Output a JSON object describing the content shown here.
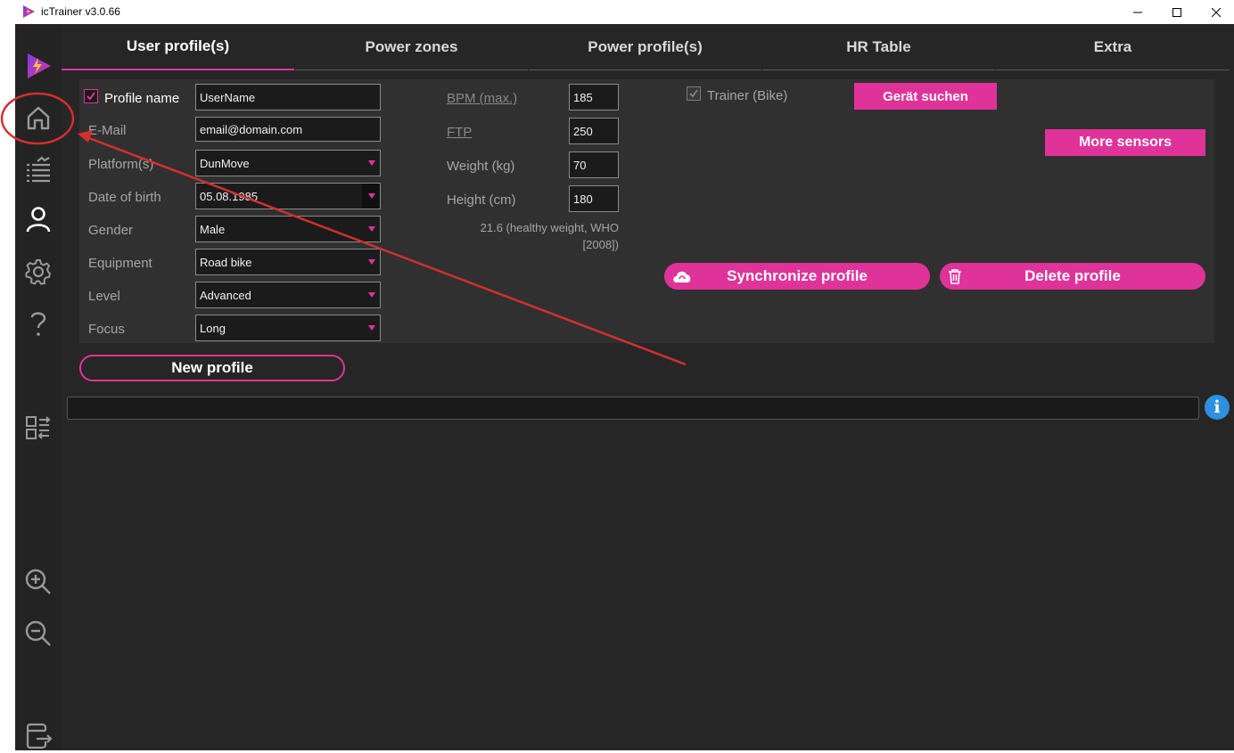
{
  "window": {
    "title": "icTrainer v3.0.66"
  },
  "tabs": [
    {
      "label": "User profile(s)",
      "active": true
    },
    {
      "label": "Power zones",
      "active": false
    },
    {
      "label": "Power profile(s)",
      "active": false
    },
    {
      "label": "HR Table",
      "active": false
    },
    {
      "label": "Extra",
      "active": false
    }
  ],
  "profile": {
    "name_label": "Profile name",
    "name_checked": true,
    "name_value": "UserName",
    "email_label": "E-Mail",
    "email_value": "email@domain.com",
    "platform_label": "Platform(s)",
    "platform_value": "DunMove",
    "dob_label": "Date of birth",
    "dob_value": "05.08.1985",
    "gender_label": "Gender",
    "gender_value": "Male",
    "equipment_label": "Equipment",
    "equipment_value": "Road bike",
    "level_label": "Level",
    "level_value": "Advanced",
    "focus_label": "Focus",
    "focus_value": "Long"
  },
  "metrics": {
    "bpm_label": "BPM (max.)",
    "bpm_value": "185",
    "ftp_label": "FTP",
    "ftp_value": "250",
    "weight_label": "Weight (kg)",
    "weight_value": "70",
    "height_label": "Height (cm)",
    "height_value": "180",
    "bmi_line1": "21.6 (healthy weight, WHO",
    "bmi_line2": "[2008])"
  },
  "devices": {
    "trainer_label": "Trainer (Bike)",
    "search_button": "Gerät suchen",
    "more_sensors_button": "More sensors",
    "sync_button": "Synchronize profile",
    "delete_button": "Delete profile"
  },
  "new_profile_button": "New profile",
  "info_glyph": "i",
  "colors": {
    "accent": "#e0339a",
    "background": "#262626",
    "panel": "#303030",
    "sidebar": "#232323",
    "info": "#2f8fe0",
    "annotation": "#d32f2f"
  },
  "sidebar_icons": [
    "logo-icon",
    "home-icon",
    "workout-list-icon",
    "user-icon",
    "gear-icon",
    "help-icon",
    "sync-icon",
    "zoom-in-icon",
    "zoom-out-icon",
    "exit-icon"
  ]
}
